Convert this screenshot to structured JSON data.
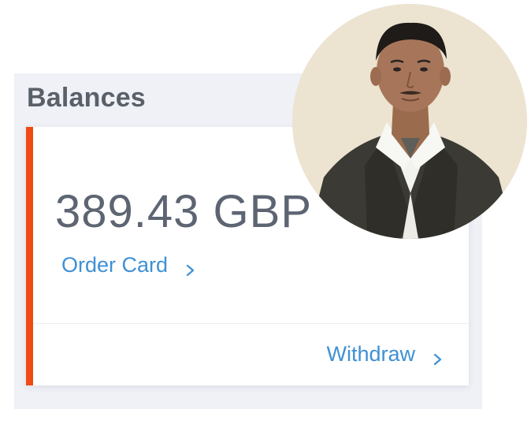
{
  "balances": {
    "title": "Balances",
    "amount": "389.43 GBP",
    "order_card_label": "Order Card",
    "withdraw_label": "Withdraw"
  },
  "colors": {
    "accent": "#f04a14",
    "link": "#3f90d4",
    "text": "#5d6472",
    "panel_bg": "#eff1f6"
  },
  "icons": {
    "order_card_chevron": "chevron-right-icon",
    "withdraw_chevron": "chevron-right-icon"
  }
}
